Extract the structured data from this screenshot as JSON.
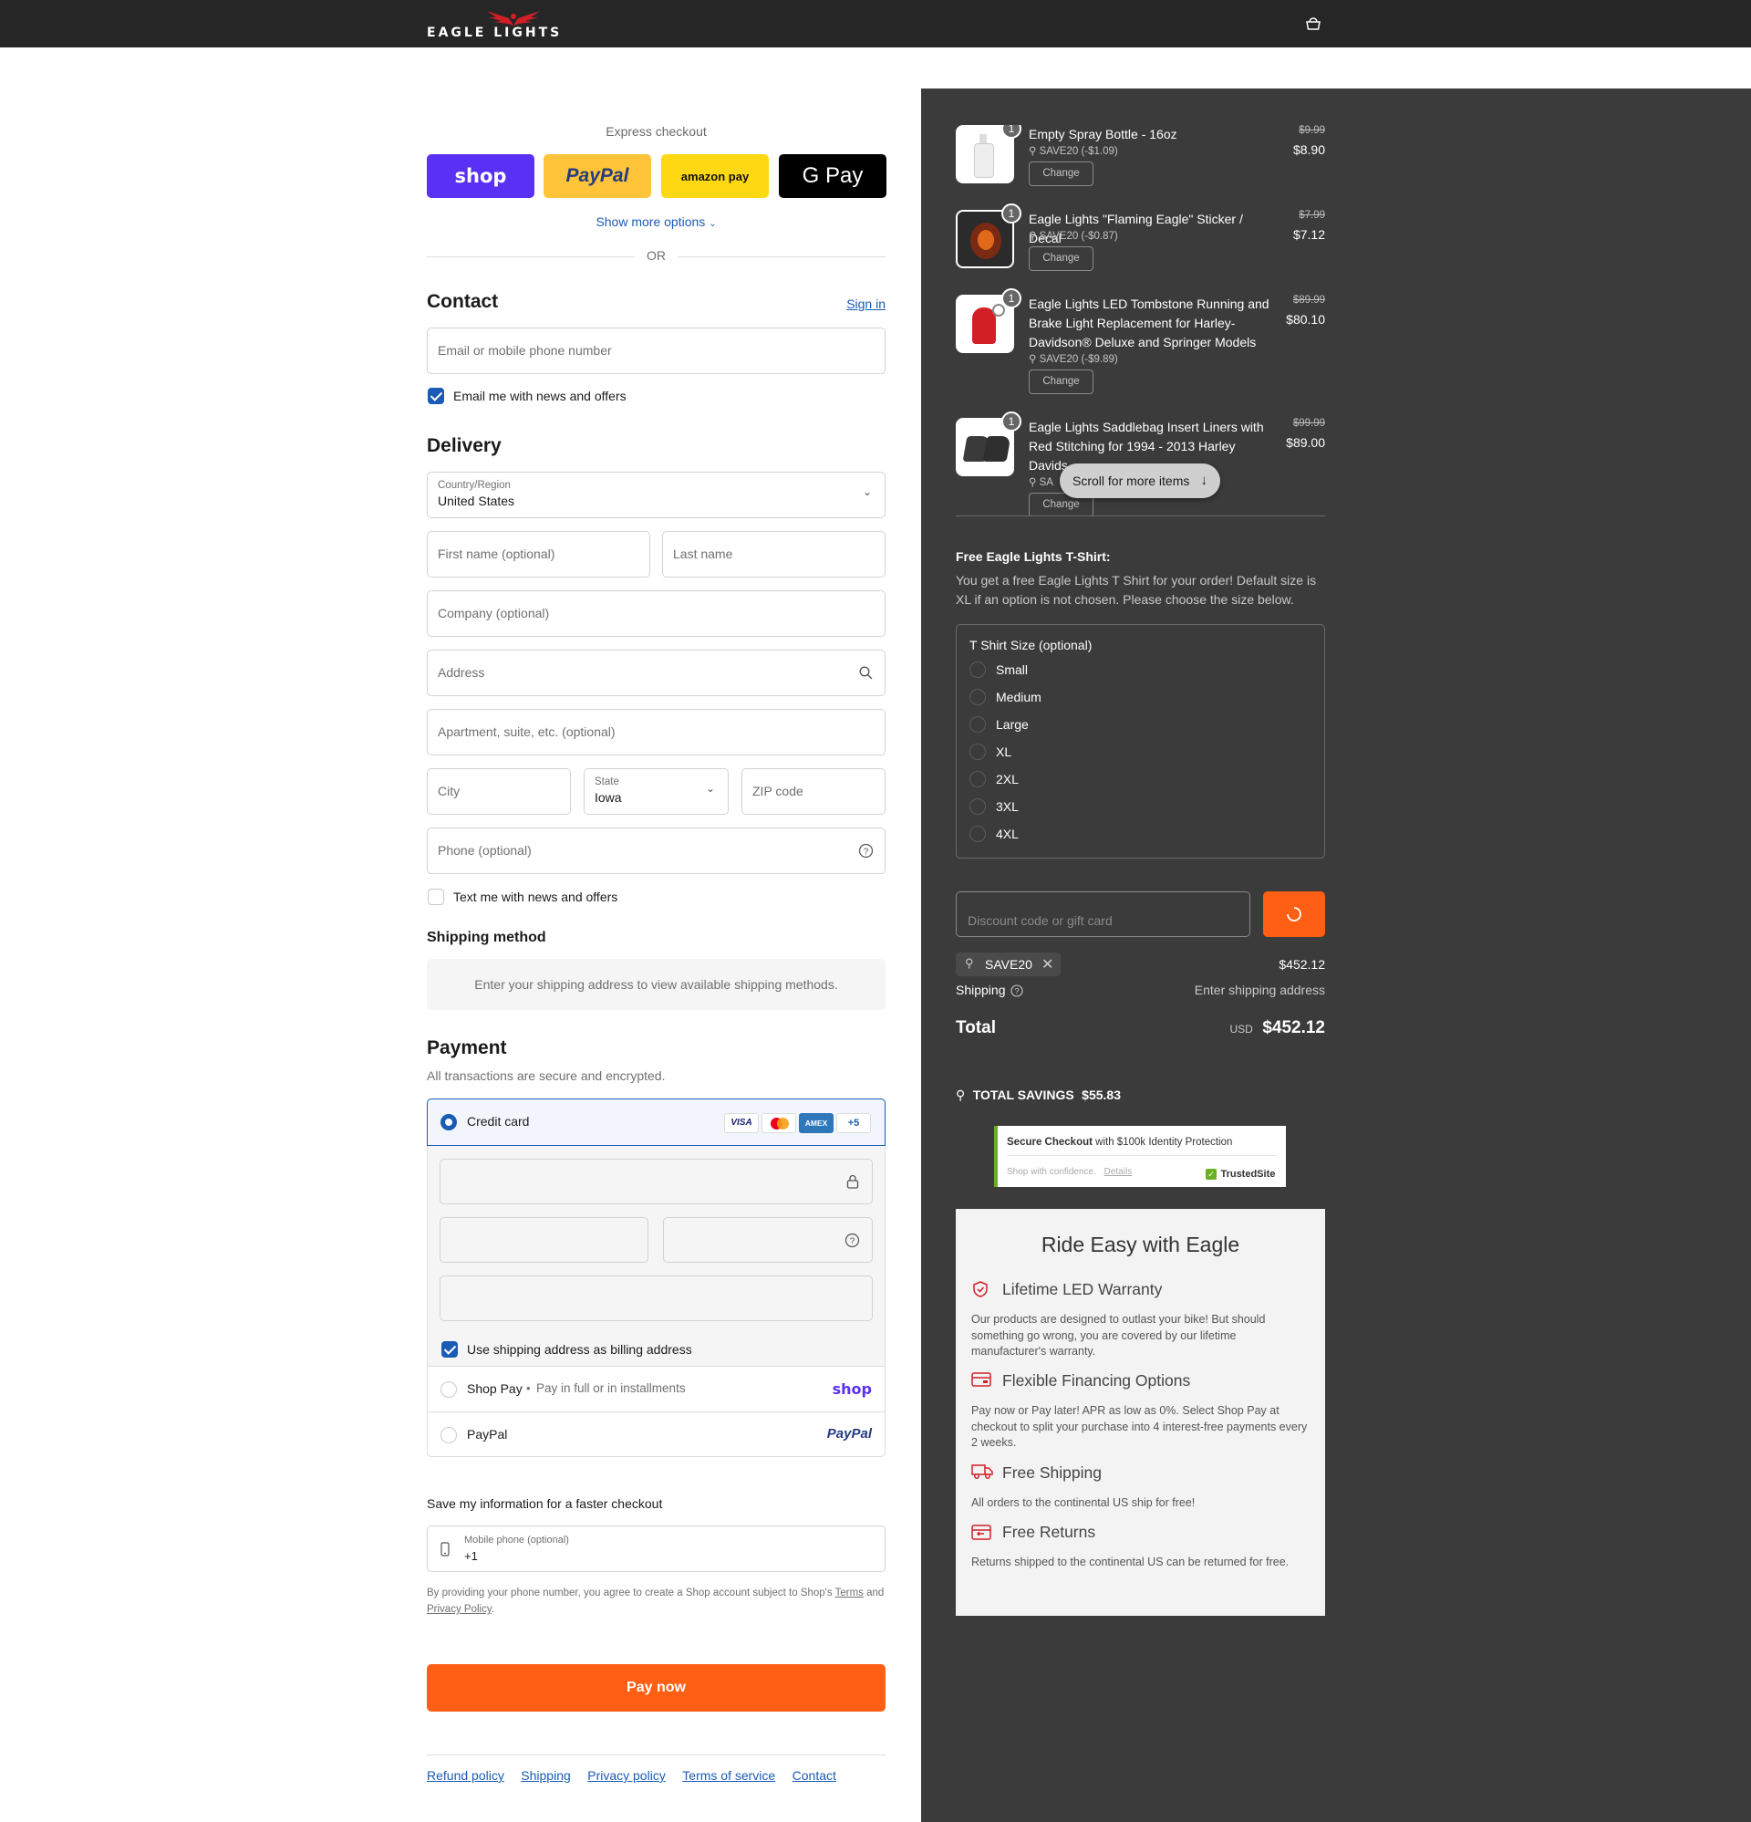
{
  "header": {
    "brand": "EAGLE LIGHTS",
    "cart_icon": "bag-icon"
  },
  "express": {
    "title": "Express checkout",
    "buttons": [
      "shop",
      "PayPal",
      "amazon pay",
      "G Pay"
    ],
    "show_more": "Show more options",
    "or": "OR"
  },
  "contact": {
    "title": "Contact",
    "sign_in": "Sign in",
    "email_placeholder": "Email or mobile phone number",
    "news_label": "Email me with news and offers"
  },
  "delivery": {
    "title": "Delivery",
    "country_label": "Country/Region",
    "country_value": "United States",
    "first_name": "First name (optional)",
    "last_name": "Last name",
    "company": "Company (optional)",
    "address": "Address",
    "apartment": "Apartment, suite, etc. (optional)",
    "city": "City",
    "state_label": "State",
    "state_value": "Iowa",
    "zip": "ZIP code",
    "phone": "Phone (optional)",
    "text_label": "Text me with news and offers"
  },
  "shipping_method": {
    "title": "Shipping method",
    "message": "Enter your shipping address to view available shipping methods."
  },
  "payment": {
    "title": "Payment",
    "subtitle": "All transactions are secure and encrypted.",
    "credit_card": "Credit card",
    "card_brands": [
      "VISA",
      "mastercard",
      "AMEX",
      "+5"
    ],
    "billing_label": "Use shipping address as billing address",
    "shop_pay": "Shop Pay",
    "shop_pay_sub": "Pay in full or in installments",
    "shop_pay_logo": "shop",
    "paypal": "PayPal",
    "paypal_logo": "PayPal"
  },
  "save_info": {
    "title": "Save my information for a faster checkout",
    "mobile_label": "Mobile phone (optional)",
    "mobile_value": "+1",
    "legal_1": "By providing your phone number, you agree to create a Shop account subject to Shop's",
    "terms": "Terms",
    "and": "and",
    "privacy": "Privacy Policy",
    "period": "."
  },
  "pay_now": "Pay now",
  "footer_links": [
    "Refund policy",
    "Shipping",
    "Privacy policy",
    "Terms of service",
    "Contact"
  ],
  "cart": {
    "items": [
      {
        "qty": "1",
        "name": "Empty Spray Bottle - 16oz",
        "discount": "SAVE20 (-$1.09)",
        "old_price": "$9.99",
        "price": "$8.90",
        "change": "Change"
      },
      {
        "qty": "1",
        "name": "Eagle Lights \"Flaming Eagle\" Sticker / Decal",
        "discount": "SAVE20 (-$0.87)",
        "old_price": "$7.99",
        "price": "$7.12",
        "change": "Change"
      },
      {
        "qty": "1",
        "name": "Eagle Lights LED Tombstone Running and Brake Light Replacement for Harley-Davidson® Deluxe and Springer Models",
        "discount": "SAVE20 (-$9.89)",
        "old_price": "$89.99",
        "price": "$80.10",
        "change": "Change"
      },
      {
        "qty": "1",
        "name": "Eagle Lights Saddlebag Insert Liners with Red Stitching for 1994 - 2013 Harley Davids",
        "discount": "SA",
        "old_price": "$99.99",
        "price": "$89.00",
        "change": "Change"
      }
    ],
    "scroll_hint": "Scroll for more items"
  },
  "tshirt": {
    "title": "Free Eagle Lights T-Shirt:",
    "desc": "You get a free Eagle Lights T Shirt for your order! Default size is XL if an option is not chosen. Please choose the size below.",
    "legend": "T Shirt Size (optional)",
    "sizes": [
      "Small",
      "Medium",
      "Large",
      "XL",
      "2XL",
      "3XL",
      "4XL"
    ]
  },
  "summary": {
    "discount_placeholder": "Discount code or gift card",
    "code": "SAVE20",
    "subtotal": "$452.12",
    "shipping_label": "Shipping",
    "shipping_value": "Enter shipping address",
    "total_label": "Total",
    "currency": "USD",
    "total": "$452.12",
    "savings_label": "TOTAL SAVINGS",
    "savings_value": "$55.83"
  },
  "trust": {
    "title_bold": "Secure Checkout",
    "title_rest": "with $100k Identity Protection",
    "sub": "Shop with confidence.",
    "details": "Details",
    "badge": "TrustedSite"
  },
  "benefits": {
    "title": "Ride Easy with Eagle",
    "items": [
      {
        "icon": "shield-icon",
        "title": "Lifetime LED Warranty",
        "text": "Our products are designed to outlast your bike! But should something go wrong, you are covered by our lifetime manufacturer's warranty."
      },
      {
        "icon": "card-icon",
        "title": "Flexible Financing Options",
        "text": "Pay now or Pay later! APR as low as 0%. Select Shop Pay at checkout to split your purchase into 4 interest-free payments every 2 weeks."
      },
      {
        "icon": "truck-icon",
        "title": "Free Shipping",
        "text": "All orders to the continental US ship for free!"
      },
      {
        "icon": "return-icon",
        "title": "Free Returns",
        "text": "Returns shipped to the continental US can be returned for free."
      }
    ]
  },
  "colors": {
    "accent": "#ff5f14",
    "link": "#1a5bb5",
    "shop": "#5a31f4",
    "paypal": "#ffc439",
    "amazon": "#ffd814",
    "panel": "#3b3b3b",
    "header": "#262626"
  }
}
